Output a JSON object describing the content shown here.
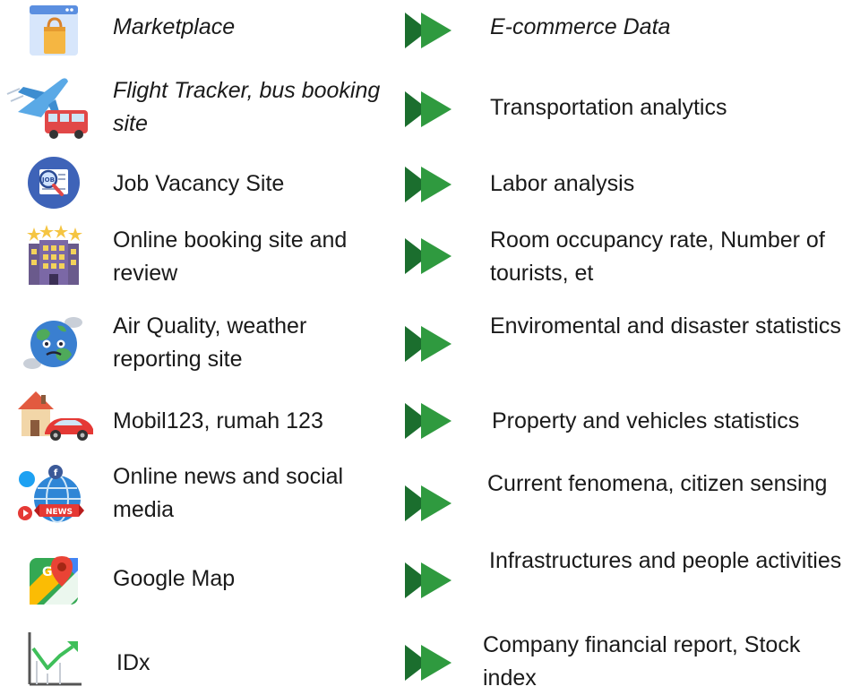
{
  "colors": {
    "arrow_dark": "#1b6e2e",
    "arrow_light": "#2f9a3f",
    "text": "#1a1a1a"
  },
  "rows": [
    {
      "icon": "marketplace-icon",
      "source": "Marketplace",
      "target": "E-commerce Data"
    },
    {
      "icon": "flight-bus-icon",
      "source": "Flight Tracker, bus booking site",
      "target": "Transportation analytics"
    },
    {
      "icon": "job-search-icon",
      "source": "Job Vacancy Site",
      "target": "Labor analysis"
    },
    {
      "icon": "hotel-icon",
      "source": "Online booking site and review",
      "target": "Room occupancy rate, Number of tourists, et"
    },
    {
      "icon": "earth-pollution-icon",
      "source": "Air Quality,  weather reporting site",
      "target": "Enviromental and disaster statistics"
    },
    {
      "icon": "house-car-icon",
      "source": "Mobil123, rumah 123",
      "target": "Property and vehicles statistics"
    },
    {
      "icon": "news-social-icon",
      "source": "Online news and social media",
      "target": "Current fenomena, citizen sensing"
    },
    {
      "icon": "google-maps-icon",
      "source": "Google Map",
      "target": "Infrastructures and people activities"
    },
    {
      "icon": "stock-chart-icon",
      "source": "IDx",
      "target": "Company financial report, Stock index"
    }
  ]
}
